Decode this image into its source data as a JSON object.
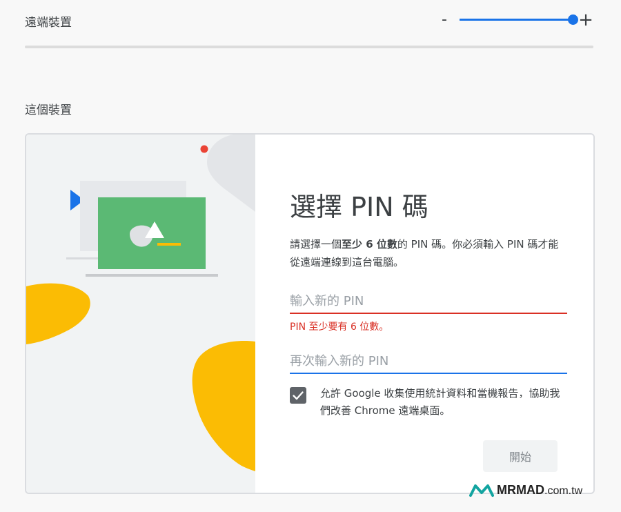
{
  "remote_section": {
    "title": "遠端裝置"
  },
  "zoom": {
    "minus_label": "-",
    "plus_label": "+",
    "level_fraction": 1.0
  },
  "this_section": {
    "title": "這個裝置"
  },
  "dialog": {
    "title": "選擇 PIN 碼",
    "description": {
      "part1": "請選擇一個",
      "bold": "至少 6 位數",
      "part2": "的 PIN 碼。你必須輸入 PIN 碼才能從遠端連線到這台電腦。"
    },
    "pin_field": {
      "placeholder": "輸入新的 PIN",
      "value": ""
    },
    "pin_error": "PIN 至少要有 6 位數。",
    "pin_confirm_field": {
      "placeholder": "再次輸入新的 PIN",
      "value": ""
    },
    "consent_checked": true,
    "consent_text": "允許 Google 收集使用統計資料和當機報告，協助我們改善 Chrome 遠端桌面。",
    "start_button": "開始"
  },
  "watermark": {
    "brand": "MRMAD",
    "suffix": ".com.tw"
  },
  "colors": {
    "accent_blue": "#1a73e8",
    "error_red": "#d93025",
    "illustration_green": "#5bb974",
    "illustration_yellow": "#fbbc04"
  },
  "icons": {
    "zoom_minus": "minus-icon",
    "zoom_plus": "plus-icon",
    "checkbox": "check-icon",
    "watermark": "mrmad-logo-icon"
  }
}
